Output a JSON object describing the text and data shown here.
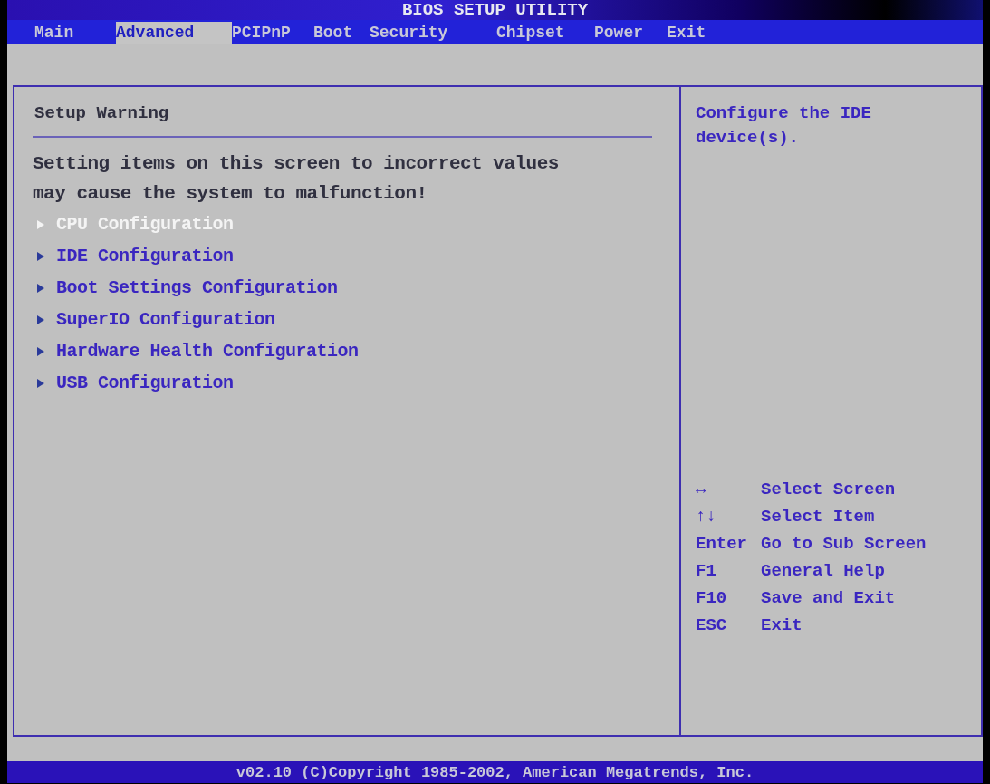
{
  "window": {
    "title": "BIOS SETUP UTILITY"
  },
  "tabs": [
    {
      "label": "Main",
      "selected": false
    },
    {
      "label": "Advanced",
      "selected": true
    },
    {
      "label": "PCIPnP",
      "selected": false
    },
    {
      "label": "Boot",
      "selected": false
    },
    {
      "label": "Security",
      "selected": false
    },
    {
      "label": "Chipset",
      "selected": false
    },
    {
      "label": "Power",
      "selected": false
    },
    {
      "label": "Exit",
      "selected": false
    }
  ],
  "main_panel": {
    "heading": "Setup Warning",
    "warning": "Setting items on this screen to incorrect values\nmay cause the system to malfunction!",
    "items": [
      {
        "label": "CPU Configuration",
        "selected": true
      },
      {
        "label": "IDE Configuration",
        "selected": false
      },
      {
        "label": "Boot Settings Configuration",
        "selected": false
      },
      {
        "label": "SuperIO Configuration",
        "selected": false
      },
      {
        "label": "Hardware Health Configuration",
        "selected": false
      },
      {
        "label": "USB Configuration",
        "selected": false
      }
    ]
  },
  "help_panel": {
    "description": "Configure the IDE\ndevice(s).",
    "keys": [
      {
        "key": "↔",
        "action": "Select Screen"
      },
      {
        "key": "↑↓",
        "action": "Select Item"
      },
      {
        "key": "Enter",
        "action": "Go to Sub Screen"
      },
      {
        "key": "F1",
        "action": "General Help"
      },
      {
        "key": "F10",
        "action": "Save and Exit"
      },
      {
        "key": "ESC",
        "action": "Exit"
      }
    ]
  },
  "status_bar": "v02.10 (C)Copyright 1985-2002, American Megatrends, Inc."
}
